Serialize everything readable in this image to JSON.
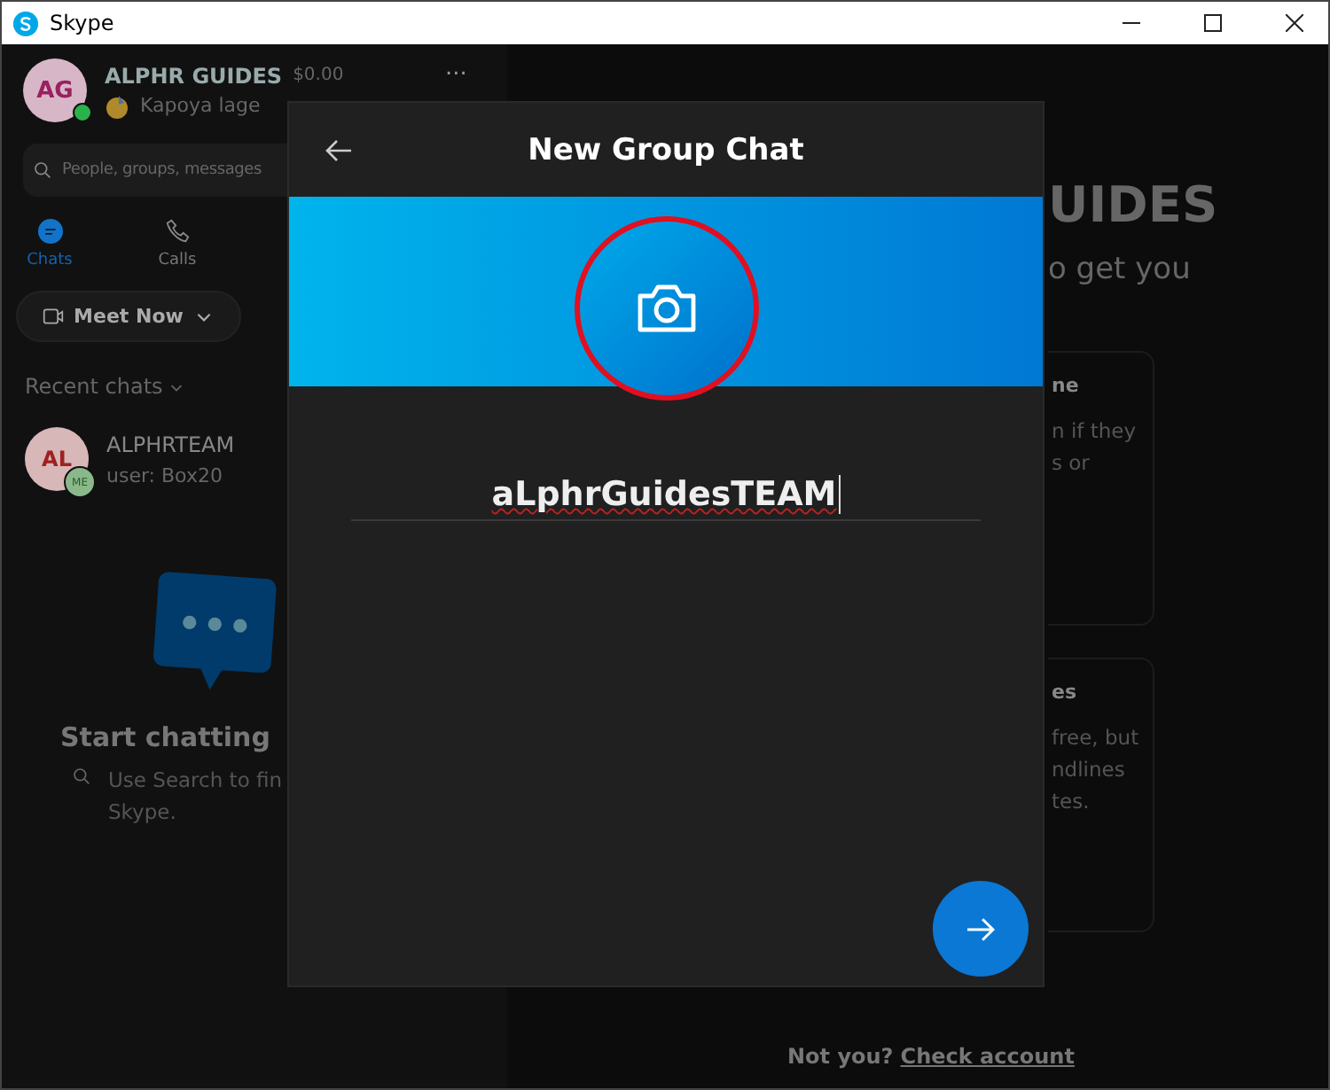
{
  "window": {
    "title": "Skype"
  },
  "profile": {
    "initials": "AG",
    "name": "ALPHR GUIDES",
    "credit": "$0.00",
    "mood": "Kapoya lage",
    "online": true,
    "more": "..."
  },
  "search": {
    "placeholder": "People, groups, messages"
  },
  "tabs": [
    {
      "label": "Chats",
      "selected": true
    },
    {
      "label": "Calls",
      "selected": false
    }
  ],
  "meet_now": {
    "label": "Meet Now"
  },
  "recent": {
    "label": "Recent chats",
    "chats": [
      {
        "initials": "AL",
        "name": "ALPHRTEAM",
        "preview": "user: Box20",
        "badge": "ME"
      }
    ]
  },
  "empty_state": {
    "title": "Start chatting",
    "text": [
      "Use Search to fin",
      "Skype."
    ]
  },
  "main": {
    "heading": "UIDES",
    "subheading": "o get you",
    "cards": [
      {
        "title": "ne",
        "lines": [
          "n if they",
          "s or"
        ]
      },
      {
        "title": "es",
        "lines": [
          "free, but",
          "ndlines",
          "tes."
        ]
      }
    ]
  },
  "dialog": {
    "title": "New Group Chat",
    "group_name": "aLphrGuidesTEAM"
  },
  "footer": {
    "prompt": "Not you?",
    "link": "Check account"
  }
}
